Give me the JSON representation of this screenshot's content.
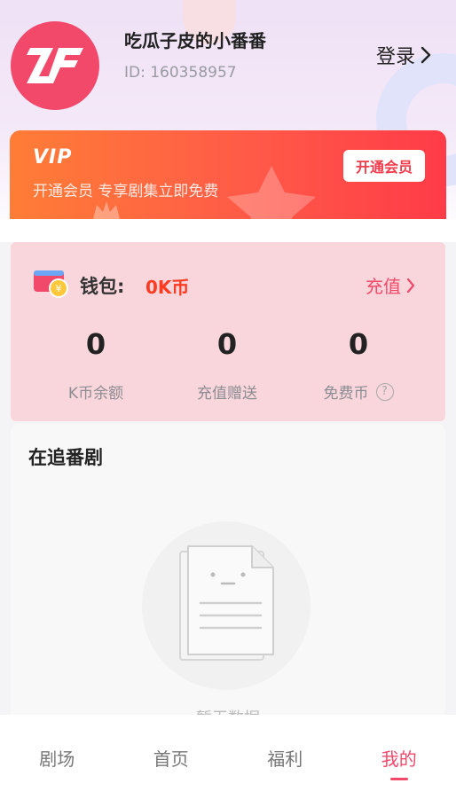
{
  "profile": {
    "username": "吃瓜子皮的小番番",
    "user_id": "ID: 160358957",
    "login_label": "登录",
    "avatar_icon": "zf-logo-icon"
  },
  "vip": {
    "logo_text": "VIP",
    "description": "开通会员  专享剧集立即免费",
    "open_button": "开通会员"
  },
  "wallet": {
    "label": "钱包:",
    "balance": "0K币",
    "recharge_label": "充值",
    "stats": [
      {
        "value": "0",
        "label": "K币余额"
      },
      {
        "value": "0",
        "label": "充值赠送"
      },
      {
        "value": "0",
        "label": "免费币"
      }
    ],
    "help_glyph": "?"
  },
  "following": {
    "title": "在追番剧",
    "empty_text": "暂无数据"
  },
  "tabbar": {
    "tabs": [
      {
        "label": "剧场",
        "active": false
      },
      {
        "label": "首页",
        "active": false
      },
      {
        "label": "福利",
        "active": false
      },
      {
        "label": "我的",
        "active": true
      }
    ]
  },
  "colors": {
    "accent": "#f2496b",
    "vip_gradient_start": "#ff7d36",
    "vip_gradient_end": "#ff3b48",
    "wallet_bg": "#f8d6db",
    "balance_color": "#ff3b22"
  }
}
